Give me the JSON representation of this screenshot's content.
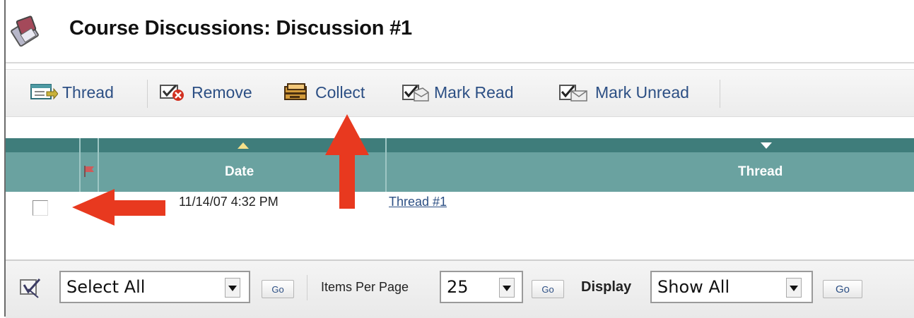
{
  "title": "Course Discussions: Discussion #1",
  "toolbar": {
    "thread_label": "Thread",
    "remove_label": "Remove",
    "collect_label": "Collect",
    "mark_read_label": "Mark Read",
    "mark_unread_label": "Mark Unread"
  },
  "table": {
    "columns": [
      "Date",
      "Thread"
    ],
    "rows": [
      {
        "date": "11/14/07 4:32 PM",
        "thread": "Thread #1",
        "selected": false
      }
    ]
  },
  "bottom": {
    "select_all_value": "Select All",
    "go1": "Go",
    "items_per_page_label": "Items Per Page",
    "items_per_page_value": "25",
    "go2": "Go",
    "display_label": "Display",
    "display_value": "Show All",
    "go3": "Go"
  },
  "colors": {
    "header_dark": "#3f7d7b",
    "header": "#6aa2a0",
    "link": "#2c4f84",
    "annotation_arrow": "#e8391f"
  }
}
